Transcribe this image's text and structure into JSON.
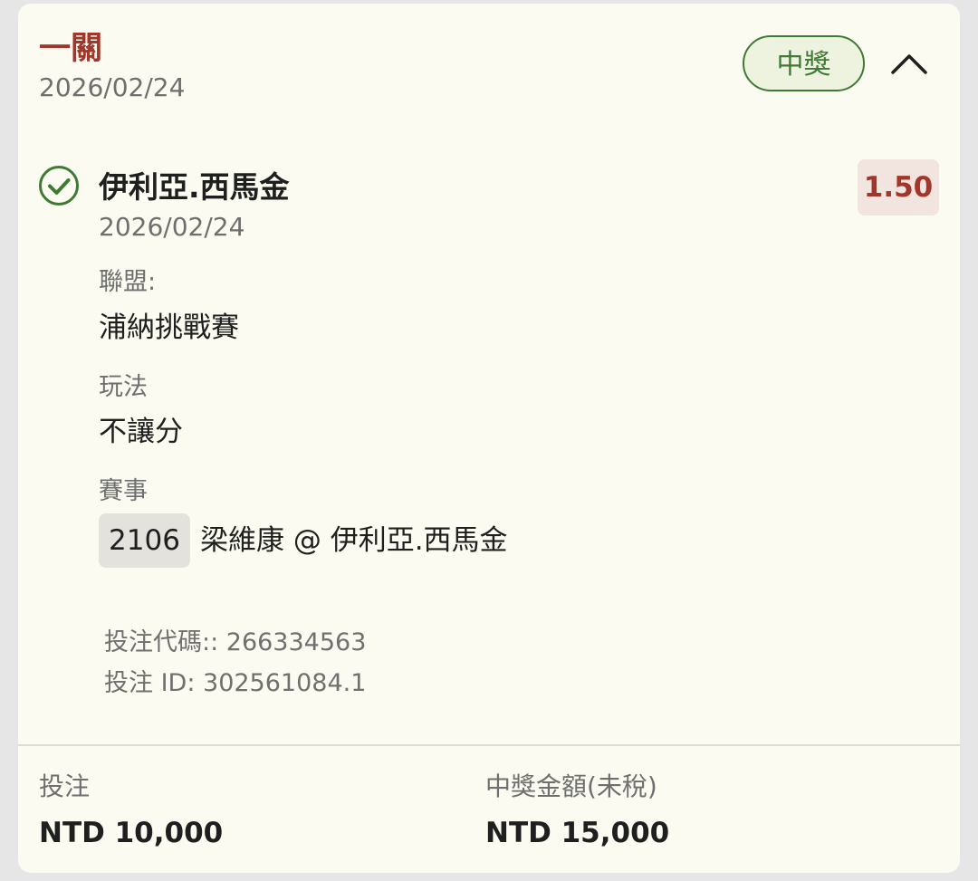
{
  "header": {
    "bet_type": "一關",
    "date": "2026/02/24",
    "status_badge": "中獎",
    "collapse_icon": "chevron-up-icon"
  },
  "selection": {
    "status_icon": "check-circle-icon",
    "name": "伊利亞.西馬金",
    "date": "2026/02/24",
    "odds": "1.50",
    "league_label": "聯盟:",
    "league_value": "浦納挑戰賽",
    "market_label": "玩法",
    "market_value": "不讓分",
    "event_label": "賽事",
    "event_number": "2106",
    "event_teams": "梁維康 @ 伊利亞.西馬金"
  },
  "references": {
    "bet_code": "投注代碼:: 266334563",
    "bet_id": "投注 ID: 302561084.1"
  },
  "summary": {
    "stake_label": "投注",
    "stake_value": "NTD 10,000",
    "payout_label": "中獎金額(未稅)",
    "payout_value": "NTD 15,000"
  },
  "colors": {
    "accent_red": "#a3362a",
    "win_green": "#3f7a35",
    "card_background": "#fbfbf1"
  }
}
